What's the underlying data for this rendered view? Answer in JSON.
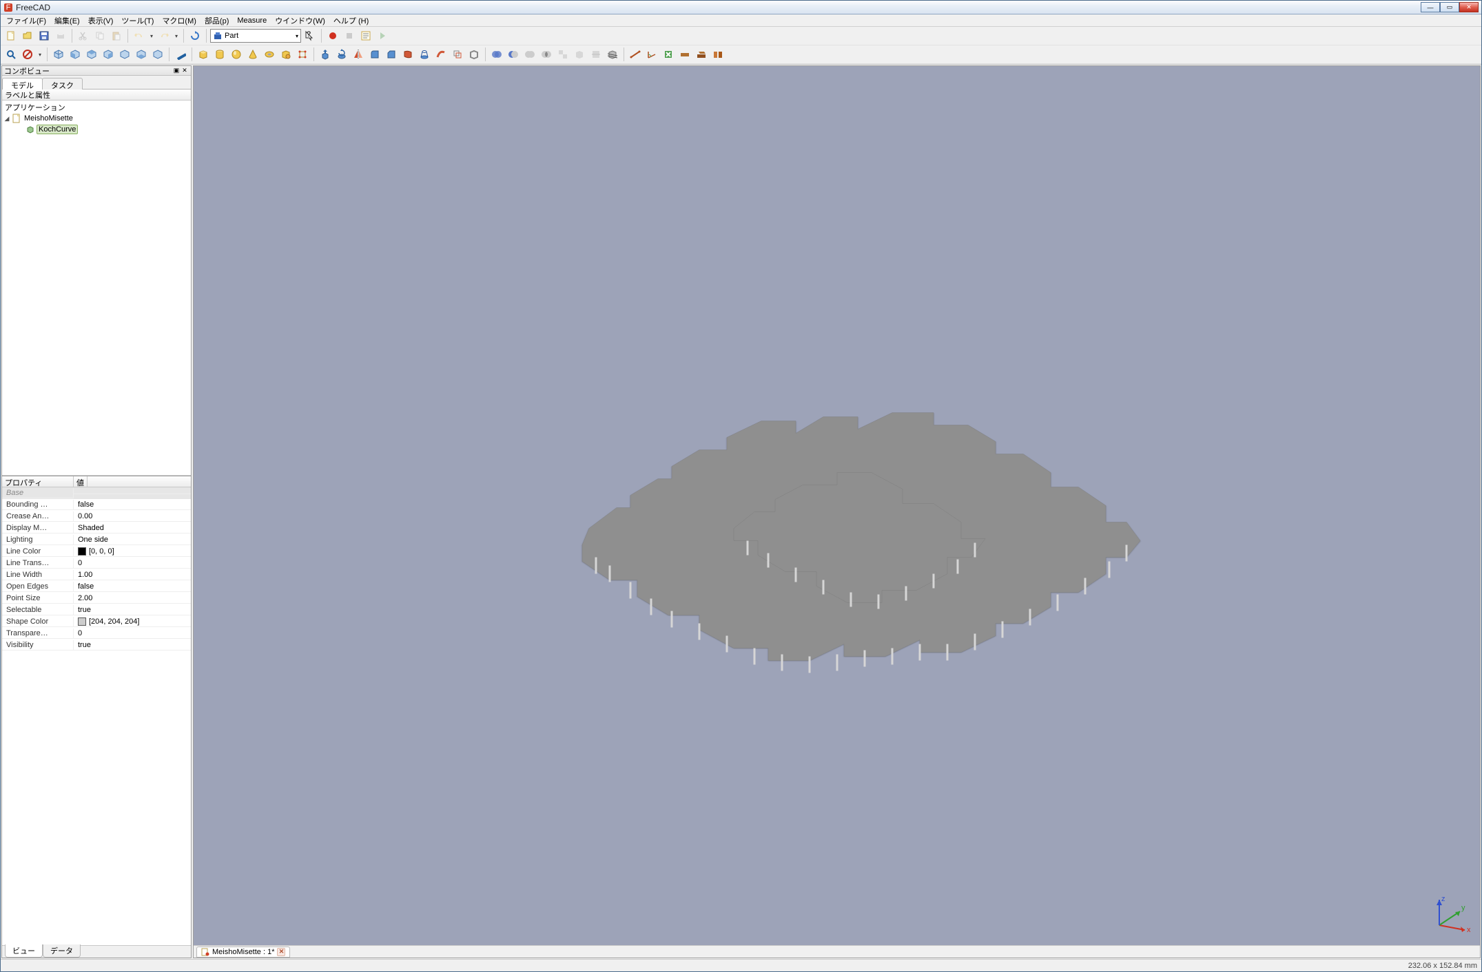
{
  "app": {
    "title": "FreeCAD"
  },
  "menu": {
    "items": [
      "ファイル(F)",
      "編集(E)",
      "表示(V)",
      "ツール(T)",
      "マクロ(M)",
      "部品(p)",
      "Measure",
      "ウインドウ(W)",
      "ヘルプ (H)"
    ]
  },
  "workbench": {
    "selected": "Part"
  },
  "comboView": {
    "title": "コンボビュー",
    "tabs": {
      "model": "モデル",
      "task": "タスク"
    },
    "treeHeader": "ラベルと属性",
    "tree": {
      "appLabel": "アプリケーション",
      "docLabel": "MeishoMisette",
      "itemLabel": "KochCurve"
    },
    "propHeader": {
      "col1": "プロパティ",
      "col2": "値"
    },
    "propGroup": "Base",
    "props": [
      {
        "name": "Bounding …",
        "value": "false"
      },
      {
        "name": "Crease An…",
        "value": "0.00"
      },
      {
        "name": "Display M…",
        "value": "Shaded"
      },
      {
        "name": "Lighting",
        "value": "One side"
      },
      {
        "name": "Line Color",
        "value": "[0, 0, 0]",
        "swatch": "#000000"
      },
      {
        "name": "Line Trans…",
        "value": "0"
      },
      {
        "name": "Line Width",
        "value": "1.00"
      },
      {
        "name": "Open Edges",
        "value": "false"
      },
      {
        "name": "Point Size",
        "value": "2.00"
      },
      {
        "name": "Selectable",
        "value": "true"
      },
      {
        "name": "Shape Color",
        "value": "[204, 204, 204]",
        "swatch": "#cccccc"
      },
      {
        "name": "Transpare…",
        "value": "0"
      },
      {
        "name": "Visibility",
        "value": "true"
      }
    ],
    "bottomTabs": {
      "view": "ビュー",
      "data": "データ"
    }
  },
  "doc": {
    "tabLabel": "MeishoMisette : 1*"
  },
  "status": {
    "dims": "232.06 x 152.84 mm"
  },
  "colors": {
    "viewport_bg": "#9da3b8",
    "shape_fill": "#8e8e8e",
    "shape_side": "#c9c9c9"
  },
  "axes": {
    "x": "x",
    "y": "y",
    "z": "z"
  }
}
